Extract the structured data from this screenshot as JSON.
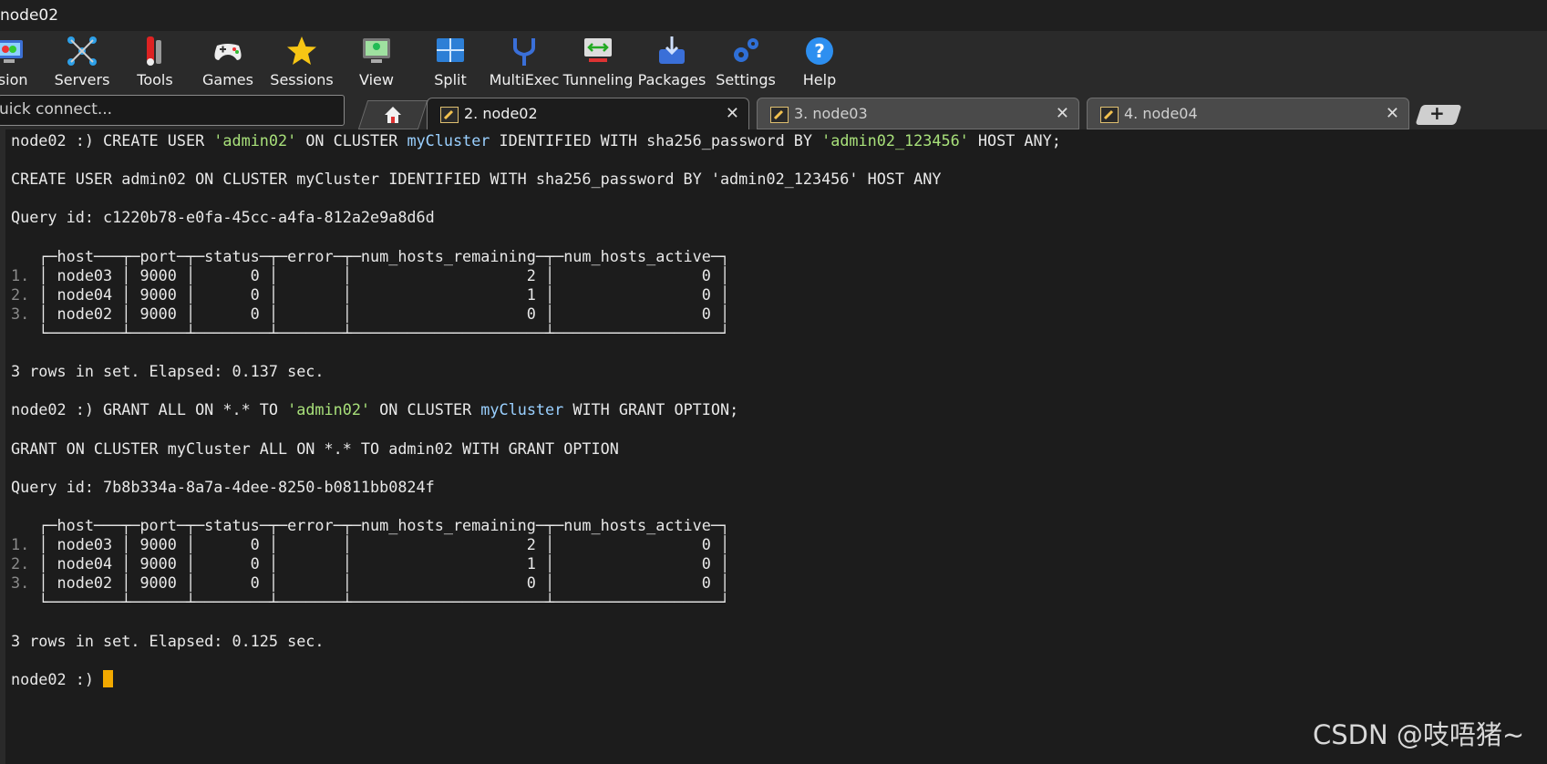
{
  "window": {
    "title": "node02"
  },
  "toolbar": {
    "items": [
      {
        "label": "ssion",
        "icon": "session-monitor-icon"
      },
      {
        "label": "Servers",
        "icon": "servers-network-icon"
      },
      {
        "label": "Tools",
        "icon": "tools-icon"
      },
      {
        "label": "Games",
        "icon": "gamepad-icon"
      },
      {
        "label": "Sessions",
        "icon": "star-icon"
      },
      {
        "label": "View",
        "icon": "view-monitor-icon"
      },
      {
        "label": "Split",
        "icon": "split-grid-icon"
      },
      {
        "label": "MultiExec",
        "icon": "fork-icon"
      },
      {
        "label": "Tunneling",
        "icon": "tunnel-icon"
      },
      {
        "label": "Packages",
        "icon": "package-icon"
      },
      {
        "label": "Settings",
        "icon": "gears-icon"
      },
      {
        "label": "Help",
        "icon": "help-icon"
      }
    ]
  },
  "quick_connect": {
    "placeholder": "uick connect..."
  },
  "tabs": [
    {
      "label": "2. node02",
      "active": true
    },
    {
      "label": "3. node03",
      "active": false
    },
    {
      "label": "4. node04",
      "active": false
    }
  ],
  "terminal": {
    "lines": [
      {
        "segs": [
          {
            "t": "node02 :) CREATE USER "
          },
          {
            "t": "'admin02'",
            "c": "str"
          },
          {
            "t": " ON CLUSTER "
          },
          {
            "t": "myCluster",
            "c": "ident"
          },
          {
            "t": " IDENTIFIED WITH sha256_password BY "
          },
          {
            "t": "'admin02_123456'",
            "c": "str"
          },
          {
            "t": " HOST ANY;"
          }
        ]
      },
      {
        "segs": [
          {
            "t": ""
          }
        ]
      },
      {
        "segs": [
          {
            "t": "CREATE USER admin02 ON CLUSTER myCluster IDENTIFIED WITH sha256_password BY 'admin02_123456' HOST ANY"
          }
        ]
      },
      {
        "segs": [
          {
            "t": ""
          }
        ]
      },
      {
        "segs": [
          {
            "t": "Query id: c1220b78-e0fa-45cc-a4fa-812a2e9a8d6d"
          }
        ]
      },
      {
        "segs": [
          {
            "t": ""
          }
        ]
      },
      {
        "segs": [
          {
            "t": "   ┌─host───┬─port─┬─status─┬─error─┬─num_hosts_remaining─┬─num_hosts_active─┐"
          }
        ]
      },
      {
        "segs": [
          {
            "t": "1. ",
            "c": "rn"
          },
          {
            "t": "│ node03 │ 9000 │      0 │       │                   2 │                0 │"
          }
        ]
      },
      {
        "segs": [
          {
            "t": "2. ",
            "c": "rn"
          },
          {
            "t": "│ node04 │ 9000 │      0 │       │                   1 │                0 │"
          }
        ]
      },
      {
        "segs": [
          {
            "t": "3. ",
            "c": "rn"
          },
          {
            "t": "│ node02 │ 9000 │      0 │       │                   0 │                0 │"
          }
        ]
      },
      {
        "segs": [
          {
            "t": "   └────────┴──────┴────────┴───────┴─────────────────────┴──────────────────┘"
          }
        ]
      },
      {
        "segs": [
          {
            "t": ""
          }
        ]
      },
      {
        "segs": [
          {
            "t": "3 rows in set. Elapsed: 0.137 sec."
          }
        ]
      },
      {
        "segs": [
          {
            "t": ""
          }
        ]
      },
      {
        "segs": [
          {
            "t": "node02 :) GRANT ALL ON *.* TO "
          },
          {
            "t": "'admin02'",
            "c": "str"
          },
          {
            "t": " ON CLUSTER "
          },
          {
            "t": "myCluster",
            "c": "ident"
          },
          {
            "t": " WITH GRANT OPTION;"
          }
        ]
      },
      {
        "segs": [
          {
            "t": ""
          }
        ]
      },
      {
        "segs": [
          {
            "t": "GRANT ON CLUSTER myCluster ALL ON *.* TO admin02 WITH GRANT OPTION"
          }
        ]
      },
      {
        "segs": [
          {
            "t": ""
          }
        ]
      },
      {
        "segs": [
          {
            "t": "Query id: 7b8b334a-8a7a-4dee-8250-b0811bb0824f"
          }
        ]
      },
      {
        "segs": [
          {
            "t": ""
          }
        ]
      },
      {
        "segs": [
          {
            "t": "   ┌─host───┬─port─┬─status─┬─error─┬─num_hosts_remaining─┬─num_hosts_active─┐"
          }
        ]
      },
      {
        "segs": [
          {
            "t": "1. ",
            "c": "rn"
          },
          {
            "t": "│ node03 │ 9000 │      0 │       │                   2 │                0 │"
          }
        ]
      },
      {
        "segs": [
          {
            "t": "2. ",
            "c": "rn"
          },
          {
            "t": "│ node04 │ 9000 │      0 │       │                   1 │                0 │"
          }
        ]
      },
      {
        "segs": [
          {
            "t": "3. ",
            "c": "rn"
          },
          {
            "t": "│ node02 │ 9000 │      0 │       │                   0 │                0 │"
          }
        ]
      },
      {
        "segs": [
          {
            "t": "   └────────┴──────┴────────┴───────┴─────────────────────┴──────────────────┘"
          }
        ]
      },
      {
        "segs": [
          {
            "t": ""
          }
        ]
      },
      {
        "segs": [
          {
            "t": "3 rows in set. Elapsed: 0.125 sec."
          }
        ]
      },
      {
        "segs": [
          {
            "t": ""
          }
        ]
      },
      {
        "segs": [
          {
            "t": "node02 :) "
          }
        ],
        "cursor": true
      }
    ]
  },
  "watermark": "CSDN @吱唔猪~",
  "colors": {
    "string": "#a8e07a",
    "identifier": "#9ad0ff",
    "cursor": "#f2a900",
    "text": "#e8e8e8"
  }
}
